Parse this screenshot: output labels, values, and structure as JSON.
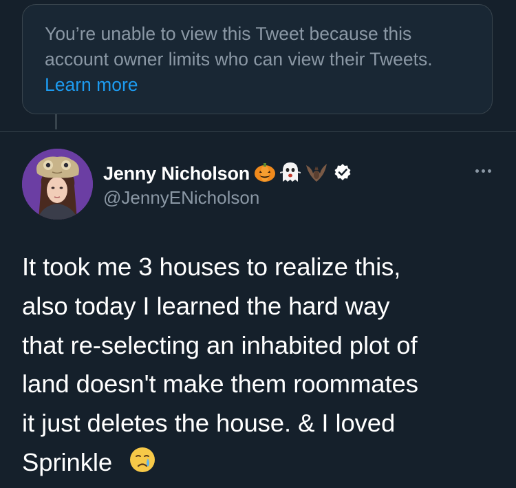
{
  "notice": {
    "text": "You’re unable to view this Tweet because this account owner limits who can view their Tweets.",
    "link": "Learn more"
  },
  "tweet": {
    "author": {
      "name": "Jenny Nicholson",
      "name_emojis": [
        "pumpkin-emoji",
        "ghost-emoji",
        "bat-emoji"
      ],
      "verified": true,
      "handle": "@JennyENicholson"
    },
    "text_lines": [
      "It took me 3 houses to realize this,",
      "also today I learned the hard way",
      "that re-selecting an inhabited plot of",
      "land doesn't make them roommates",
      "it just deletes the house. & I loved",
      "Sprinkle"
    ],
    "trailing_emoji": "crying-face-emoji"
  },
  "colors": {
    "background": "#15202b",
    "notice_bg": "#192734",
    "border": "#38444d",
    "secondary_text": "#8b98a5",
    "link": "#1d9bf0",
    "verified": "#ffffff"
  }
}
